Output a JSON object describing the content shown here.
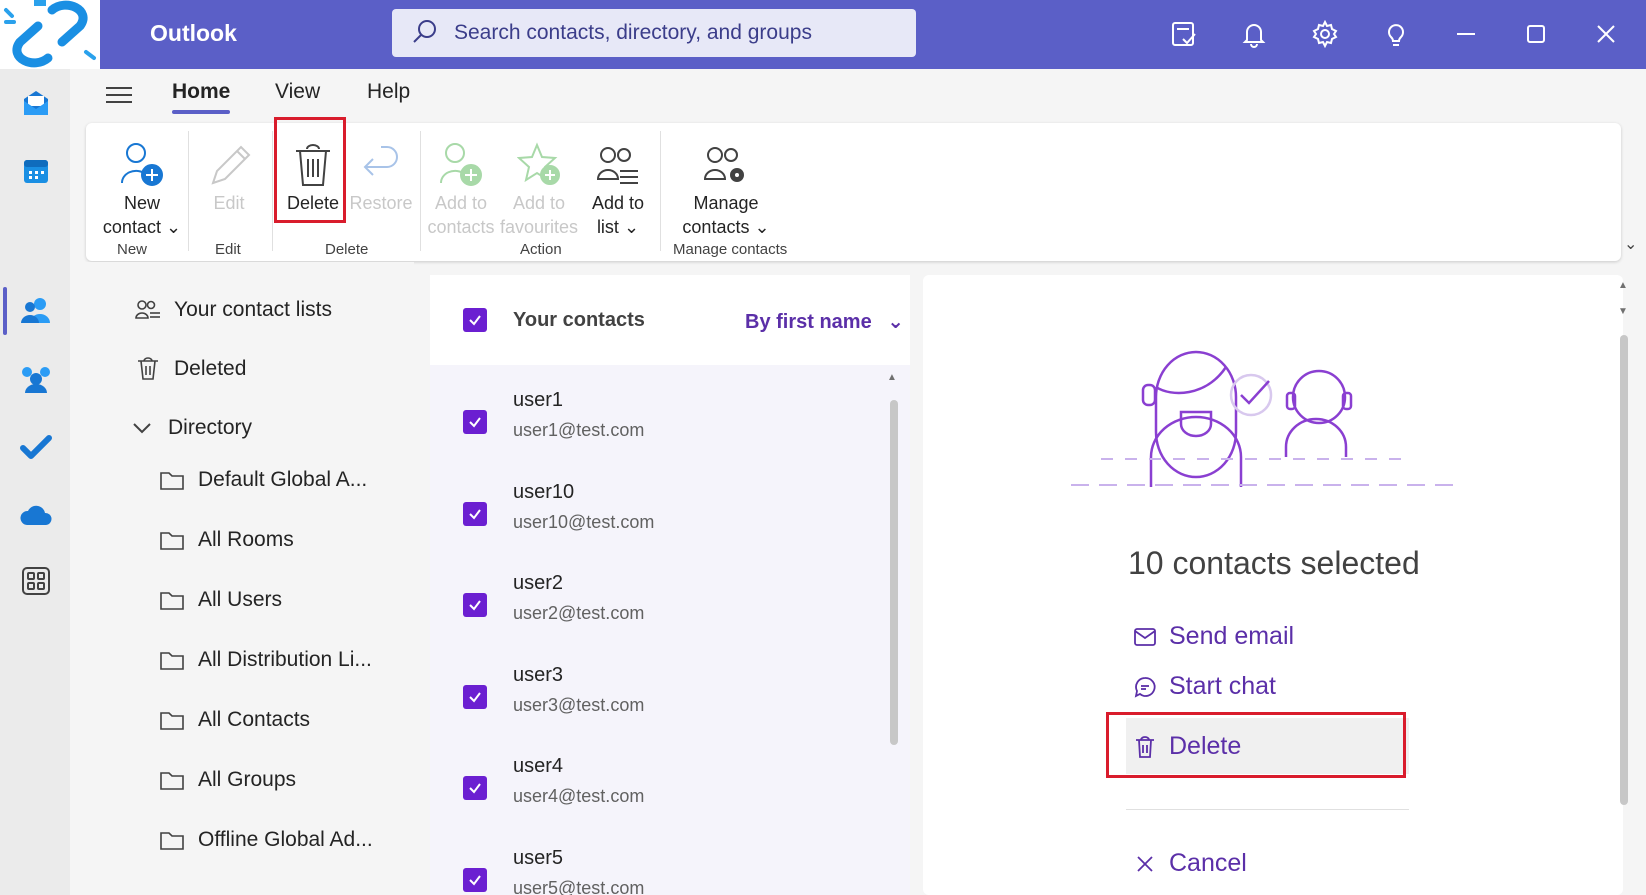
{
  "app": {
    "title": "Outlook"
  },
  "search": {
    "placeholder": "Search contacts, directory, and groups"
  },
  "menu": {
    "tabs": [
      "Home",
      "View",
      "Help"
    ]
  },
  "ribbon": {
    "new_contact": [
      "New",
      "contact"
    ],
    "edit": "Edit",
    "delete": "Delete",
    "restore": "Restore",
    "add_to_contacts": [
      "Add to",
      "contacts"
    ],
    "add_to_favourites": [
      "Add to",
      "favourites"
    ],
    "add_to_list": [
      "Add to",
      "list"
    ],
    "manage_contacts": [
      "Manage",
      "contacts"
    ],
    "groups": [
      "New",
      "Edit",
      "Delete",
      "Action",
      "Manage contacts"
    ]
  },
  "folders": {
    "your_contact_lists": "Your contact lists",
    "deleted": "Deleted",
    "directory": "Directory",
    "items": [
      "Default Global A...",
      "All Rooms",
      "All Users",
      "All Distribution Li...",
      "All Contacts",
      "All Groups",
      "Offline Global Ad..."
    ]
  },
  "contacts": {
    "header": "Your contacts",
    "sort": "By first name",
    "rows": [
      {
        "name": "user1",
        "email": "user1@test.com"
      },
      {
        "name": "user10",
        "email": "user10@test.com"
      },
      {
        "name": "user2",
        "email": "user2@test.com"
      },
      {
        "name": "user3",
        "email": "user3@test.com"
      },
      {
        "name": "user4",
        "email": "user4@test.com"
      },
      {
        "name": "user5",
        "email": "user5@test.com"
      }
    ]
  },
  "reading": {
    "selected_count": "10 contacts selected",
    "send_email": "Send email",
    "start_chat": "Start chat",
    "delete": "Delete",
    "cancel": "Cancel"
  },
  "colors": {
    "brand": "#5b5fc7",
    "checkbox": "#6b1fd1",
    "highlight": "#d91c2c",
    "action_text": "#5b2fa8"
  }
}
